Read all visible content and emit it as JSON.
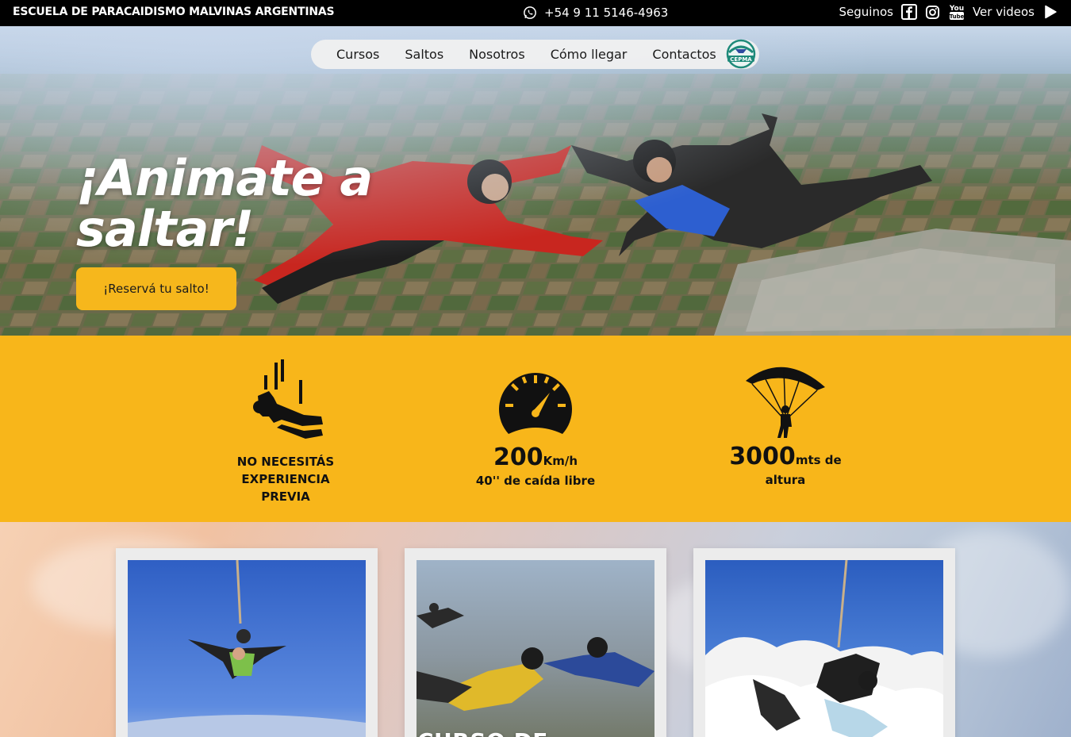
{
  "topbar": {
    "brand": "ESCUELA DE PARACAIDISMO MALVINAS ARGENTINAS",
    "phone": "+54 9 11 5146-4963",
    "phone_icon": "whatsapp-icon",
    "follow_label": "Seguinos",
    "social_icons": [
      "facebook-icon",
      "instagram-icon",
      "youtube-icon"
    ],
    "videos_label": "Ver videos",
    "videos_icon": "play-icon"
  },
  "nav": {
    "items": [
      "Cursos",
      "Saltos",
      "Nosotros",
      "Cómo llegar",
      "Contactos"
    ],
    "logo_text": "CEPMA"
  },
  "hero": {
    "headline_line1": "¡Animate a",
    "headline_line2": "saltar!",
    "cta_label": "¡Reservá tu salto!"
  },
  "features": {
    "experience": {
      "line1": "NO NECESITÁS",
      "line2": "EXPERIENCIA",
      "line3": "PREVIA",
      "icon": "freefall-person-icon"
    },
    "speed": {
      "number": "200",
      "unit": "Km/h",
      "caption": "40'' de caída libre",
      "icon": "speedometer-icon"
    },
    "height": {
      "number": "3000",
      "unit": "mts de",
      "caption": "altura",
      "icon": "parachute-icon"
    }
  },
  "cards": [
    {
      "title": "",
      "photo": "tandem-jump-photo"
    },
    {
      "title": "CURSO DE",
      "photo": "formation-skydive-photo"
    },
    {
      "title": "",
      "photo": "tandem-clouds-photo"
    }
  ],
  "colors": {
    "accent": "#f8b61a",
    "button": "#f6b71c",
    "topbar": "#000000"
  }
}
